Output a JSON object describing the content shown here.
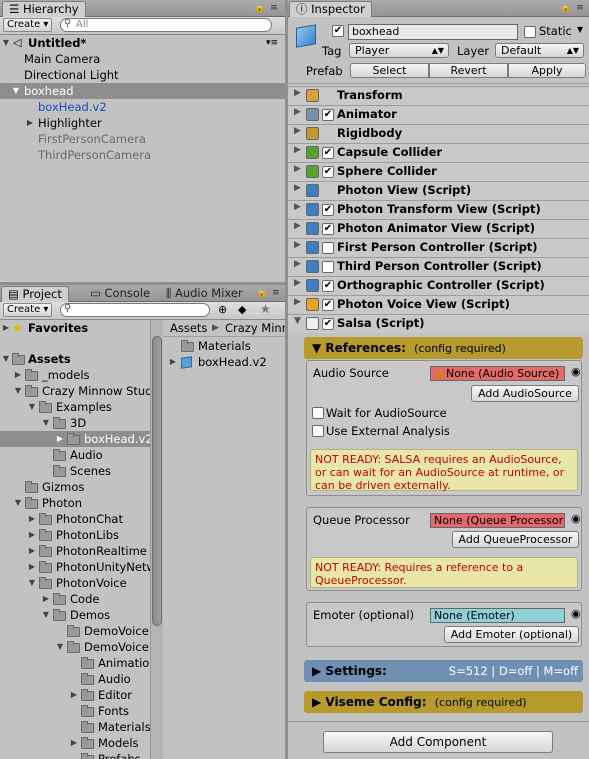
{
  "hierarchy": {
    "tab": "Hierarchy",
    "create_label": "Create ▾",
    "search_placeholder": "All",
    "scene": "Untitled*",
    "items": [
      {
        "label": "Main Camera"
      },
      {
        "label": "Directional Light"
      },
      {
        "label": "boxhead"
      },
      {
        "label": "boxHead.v2"
      },
      {
        "label": "Highlighter"
      },
      {
        "label": "FirstPersonCamera"
      },
      {
        "label": "ThirdPersonCamera"
      }
    ]
  },
  "project": {
    "tabs": [
      "Project",
      "Console",
      "Audio Mixer"
    ],
    "create_label": "Create ▾",
    "tree": [
      {
        "label": "Favorites"
      },
      {
        "label": "Assets"
      },
      {
        "label": "_models"
      },
      {
        "label": "Crazy Minnow Studio"
      },
      {
        "label": "Examples"
      },
      {
        "label": "3D"
      },
      {
        "label": "boxHead.v2"
      },
      {
        "label": "Audio"
      },
      {
        "label": "Scenes"
      },
      {
        "label": "Gizmos"
      },
      {
        "label": "Photon"
      },
      {
        "label": "PhotonChat"
      },
      {
        "label": "PhotonLibs"
      },
      {
        "label": "PhotonRealtime"
      },
      {
        "label": "PhotonUnityNetworking"
      },
      {
        "label": "PhotonVoice"
      },
      {
        "label": "Code"
      },
      {
        "label": "Demos"
      },
      {
        "label": "DemoVoice"
      },
      {
        "label": "DemoVoice"
      },
      {
        "label": "Animations"
      },
      {
        "label": "Audio"
      },
      {
        "label": "Editor"
      },
      {
        "label": "Fonts"
      },
      {
        "label": "Materials"
      },
      {
        "label": "Models"
      },
      {
        "label": "Prefabs"
      }
    ],
    "breadcrumb": [
      "Assets",
      "Crazy Minnow Studio"
    ],
    "files": [
      {
        "label": "Materials"
      },
      {
        "label": "boxHead.v2"
      }
    ]
  },
  "inspector": {
    "tab": "Inspector",
    "object_name": "boxhead",
    "static_label": "Static",
    "tag_label": "Tag",
    "tag_value": "Player",
    "layer_label": "Layer",
    "layer_value": "Default",
    "prefab_label": "Prefab",
    "prefab_select": "Select",
    "prefab_revert": "Revert",
    "prefab_apply": "Apply",
    "components": [
      {
        "name": "Transform",
        "checkbox": "none",
        "color": "#d9a13a"
      },
      {
        "name": "Animator",
        "checkbox": "checked",
        "color": "#7a8fa8"
      },
      {
        "name": "Rigidbody",
        "checkbox": "none",
        "color": "#c49a2e"
      },
      {
        "name": "Capsule Collider",
        "checkbox": "checked",
        "color": "#5aa02c"
      },
      {
        "name": "Sphere Collider",
        "checkbox": "checked",
        "color": "#5aa02c"
      },
      {
        "name": "Photon View (Script)",
        "checkbox": "none",
        "color": "#3f7ec0"
      },
      {
        "name": "Photon Transform View (Script)",
        "checkbox": "checked",
        "color": "#3f7ec0"
      },
      {
        "name": "Photon Animator View (Script)",
        "checkbox": "checked",
        "color": "#3f7ec0"
      },
      {
        "name": "First Person Controller (Script)",
        "checkbox": "unchecked",
        "color": "#3f7ec0"
      },
      {
        "name": "Third Person Controller (Script)",
        "checkbox": "unchecked",
        "color": "#3f7ec0"
      },
      {
        "name": "Orthographic Controller (Script)",
        "checkbox": "checked",
        "color": "#3f7ec0"
      },
      {
        "name": "Photon Voice View (Script)",
        "checkbox": "checked",
        "color": "#e8a020"
      },
      {
        "name": "Salsa (Script)",
        "checkbox": "checked",
        "color": "#f0f0f0"
      }
    ],
    "salsa": {
      "references_title": "References:",
      "references_note": "(config required)",
      "audio_source_label": "Audio Source",
      "audio_source_value": "None (Audio Source)",
      "add_audiosource": "Add AudioSource",
      "wait_label": "Wait for AudioSource",
      "external_label": "Use External Analysis",
      "warn1": "NOT READY: SALSA requires an AudioSource, or can wait for an AudioSource at runtime, or can be driven externally.",
      "queue_label": "Queue Processor",
      "queue_value": "None (Queue Processor)",
      "add_queue": "Add QueueProcessor",
      "warn2": "NOT READY: Requires a reference to a QueueProcessor.",
      "emoter_label": "Emoter (optional)",
      "emoter_value": "None (Emoter)",
      "add_emoter": "Add Emoter (optional)",
      "settings_title": "Settings:",
      "settings_summary": "S=512 | D=off | M=off",
      "viseme_title": "Viseme Config:",
      "viseme_note": "(config required)"
    },
    "add_component": "Add Component"
  },
  "colors": {
    "references_header": "#b79a2c",
    "settings_header": "#6f8fb3",
    "viseme_header": "#b79a2c",
    "error_field": "#e26a6a",
    "emoter_field": "#8fd0d8"
  }
}
